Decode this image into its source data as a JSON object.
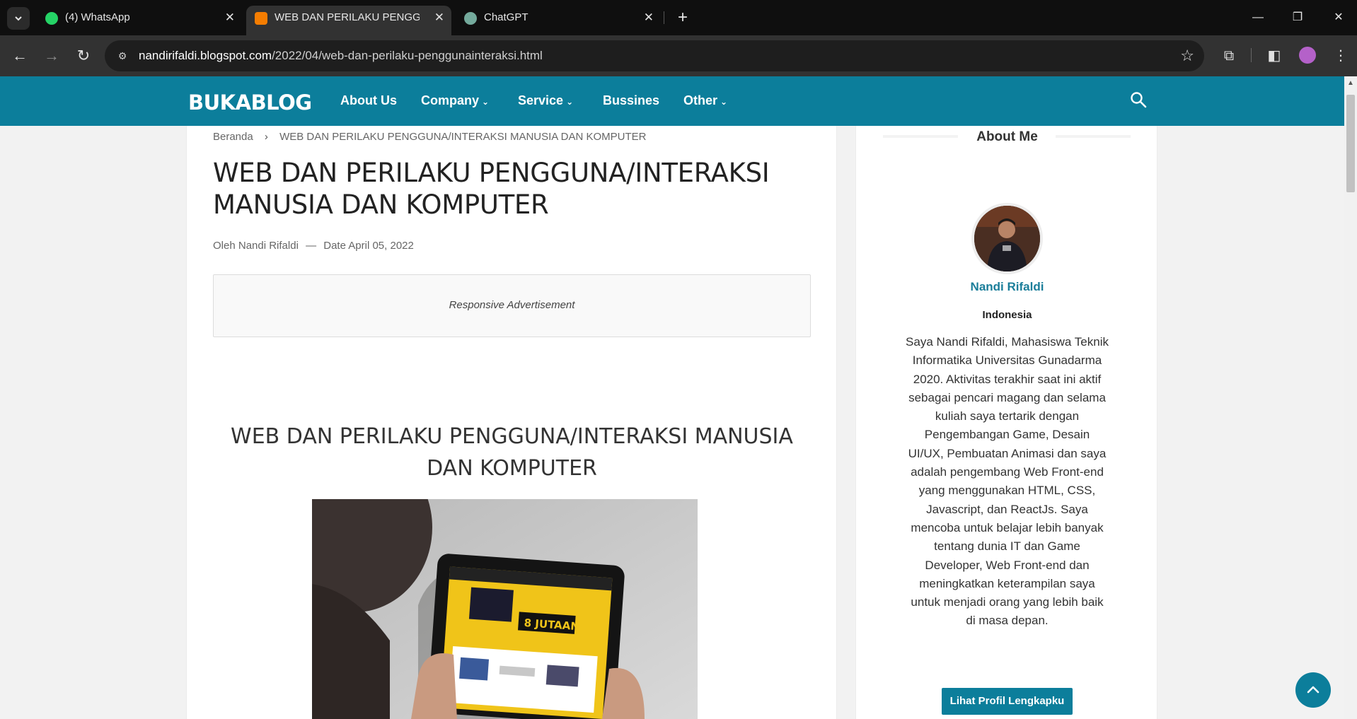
{
  "browser": {
    "tabs": [
      {
        "title": "(4) WhatsApp",
        "favicon": "whatsapp-icon",
        "active": false
      },
      {
        "title": "WEB DAN PERILAKU PENGGUNA",
        "favicon": "blogger-icon",
        "active": true
      },
      {
        "title": "ChatGPT",
        "favicon": "chatgpt-icon",
        "active": false
      }
    ],
    "url_host": "nandirifaldi.blogspot.com",
    "url_path": "/2022/04/web-dan-perilaku-penggunainteraksi.html"
  },
  "header": {
    "logo": "BUKABLOG",
    "menu": [
      {
        "label": "About Us",
        "dropdown": false
      },
      {
        "label": "Company",
        "dropdown": true
      },
      {
        "label": "Service",
        "dropdown": true
      },
      {
        "label": "Bussines",
        "dropdown": false
      },
      {
        "label": "Other",
        "dropdown": true
      }
    ]
  },
  "post": {
    "breadcrumb_home": "Beranda",
    "breadcrumb_current": "WEB DAN PERILAKU PENGGUNA/INTERAKSI MANUSIA DAN KOMPUTER",
    "title": "WEB DAN PERILAKU PENGGUNA/INTERAKSI MANUSIA DAN KOMPUTER",
    "author_prefix": "Oleh",
    "author": "Nandi Rifaldi",
    "date_prefix": "Date",
    "date": "April 05, 2022",
    "ad_text": "Responsive Advertisement",
    "content_heading": "WEB DAN PERILAKU PENGGUNA/INTERAKSI MANUSIA DAN KOMPUTER",
    "image_banner_text": "8 JUTAAN"
  },
  "sidebar": {
    "widget_title": "About Me",
    "name": "Nandi Rifaldi",
    "location": "Indonesia",
    "bio": "Saya Nandi Rifaldi, Mahasiswa Teknik Informatika Universitas Gunadarma 2020. Aktivitas terakhir saat ini aktif sebagai pencari magang dan selama kuliah saya tertarik dengan Pengembangan Game, Desain UI/UX, Pembuatan Animasi dan saya adalah pengembang Web Front-end yang menggunakan HTML, CSS, Javascript, dan ReactJs. Saya mencoba untuk belajar lebih banyak tentang dunia IT dan Game Developer, Web Front-end dan meningkatkan keterampilan saya untuk menjadi orang yang lebih baik di masa depan.",
    "button_label": "Lihat Profil Lengkapku"
  },
  "colors": {
    "brand": "#0c7e9b",
    "chrome_dark": "#0f0f0f",
    "chrome_mid": "#323232"
  }
}
